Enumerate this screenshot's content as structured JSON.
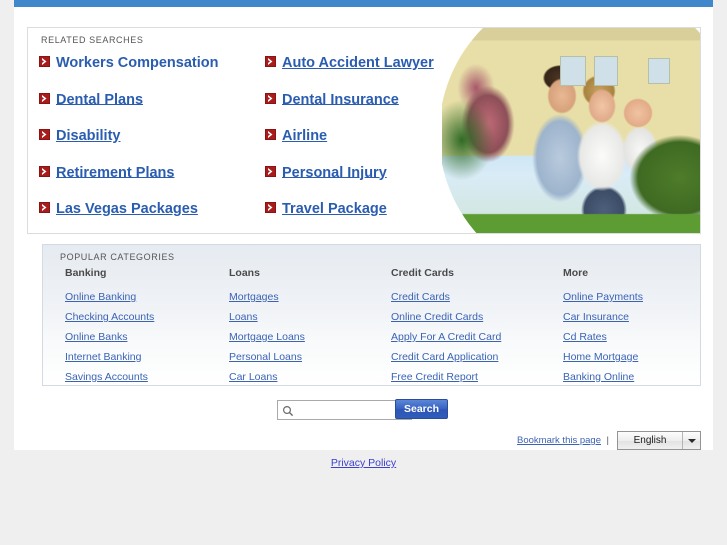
{
  "theme": {
    "topbar_color": "#4187cb",
    "link_color": "#2a5db0",
    "bullet_color": "#a81c1c",
    "button_color": "#2f5cbb",
    "page_bg": "#efefef"
  },
  "related": {
    "heading": "RELATED SEARCHES",
    "bullet_icon": "red-chevron-icon",
    "rows": [
      {
        "left": "Workers Compensation",
        "right": "Auto Accident Lawyer"
      },
      {
        "left": "Dental Plans",
        "right": "Dental Insurance"
      },
      {
        "left": "Disability",
        "right": "Airline"
      },
      {
        "left": "Retirement Plans",
        "right": "Personal Injury"
      },
      {
        "left": "Las Vegas Packages",
        "right": "Travel Package"
      }
    ]
  },
  "photo": {
    "alt": "family-with-baby-in-front-of-house-photo"
  },
  "categories": {
    "heading": "POPULAR CATEGORIES",
    "columns": [
      {
        "header": "Banking",
        "links": [
          "Online Banking",
          "Checking Accounts",
          "Online Banks",
          "Internet Banking",
          "Savings Accounts"
        ]
      },
      {
        "header": "Loans",
        "links": [
          "Mortgages",
          "Loans",
          "Mortgage Loans",
          "Personal Loans",
          "Car Loans"
        ]
      },
      {
        "header": "Credit Cards",
        "links": [
          "Credit Cards",
          "Online Credit Cards",
          "Apply For A Credit Card",
          "Credit Card Application",
          "Free Credit Report"
        ]
      },
      {
        "header": "More",
        "links": [
          "Online Payments",
          "Car Insurance",
          "Cd Rates",
          "Home Mortgage",
          "Banking Online"
        ]
      }
    ]
  },
  "search": {
    "value": "",
    "placeholder": "",
    "icon": "magnifier-icon",
    "button_label": "Search"
  },
  "footer": {
    "bookmark_label": "Bookmark this page",
    "separator": "|",
    "language_selected": "English",
    "language_options": [
      "English"
    ],
    "privacy_label": "Privacy Policy"
  }
}
